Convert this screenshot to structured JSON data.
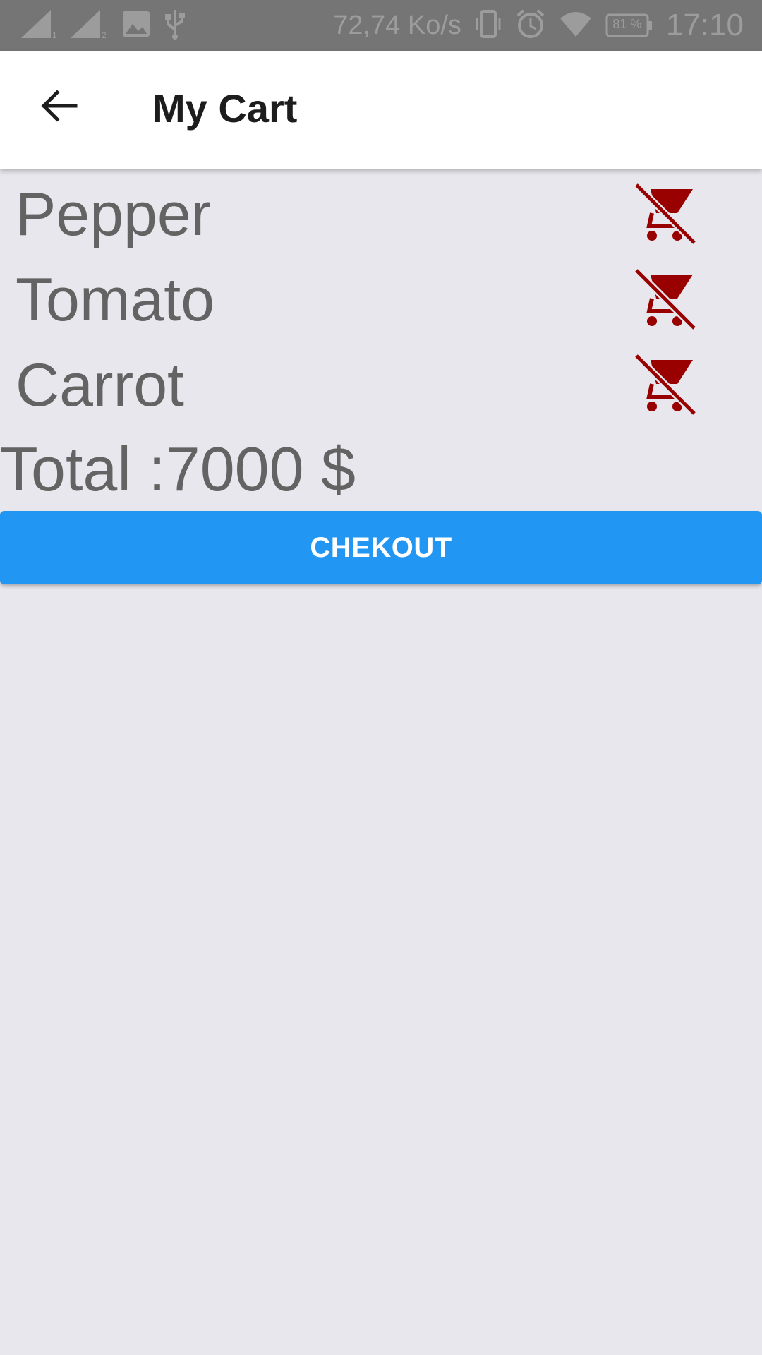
{
  "status_bar": {
    "network_speed": "72,74 Ko/s",
    "battery": "81 %",
    "time": "17:10",
    "icons": [
      "signal-sim1-icon",
      "signal-sim2-icon",
      "image-notification-icon",
      "usb-icon",
      "vibrate-icon",
      "alarm-icon",
      "wifi-icon",
      "battery-icon"
    ]
  },
  "app_bar": {
    "back_icon": "arrow-left-icon",
    "title": "My Cart"
  },
  "cart": {
    "items": [
      {
        "name": "Pepper",
        "icon": "remove-shopping-cart-icon"
      },
      {
        "name": "Tomato",
        "icon": "remove-shopping-cart-icon"
      },
      {
        "name": "Carrot",
        "icon": "remove-shopping-cart-icon"
      }
    ],
    "total_label": "Total :7000 $"
  },
  "checkout": {
    "label": "CHEKOUT"
  },
  "colors": {
    "accent": "#2196f3",
    "remove_icon": "#990000",
    "background": "#e7e7ed",
    "text": "#636363",
    "status_bar": "#757575"
  }
}
